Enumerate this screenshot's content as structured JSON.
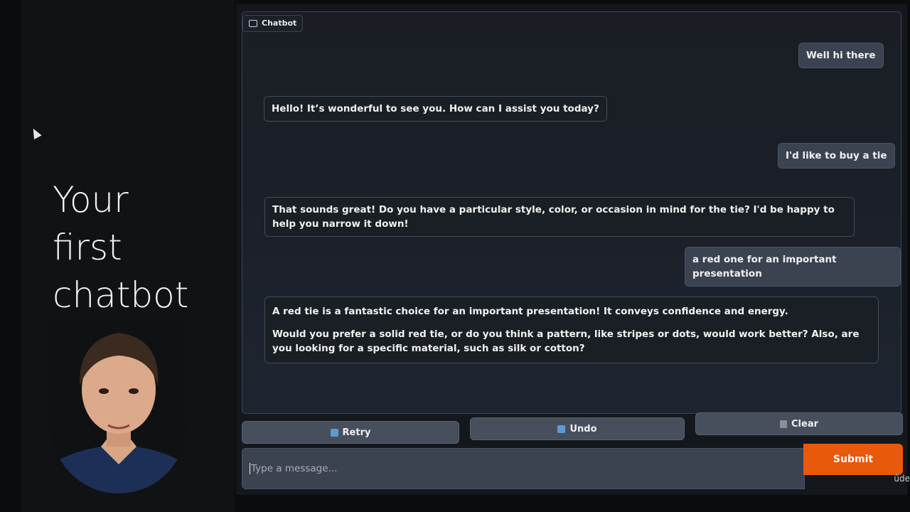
{
  "overlay": {
    "headline_lines": [
      "Your",
      "first",
      "chatbot"
    ],
    "watermark": "ûde"
  },
  "chatbot": {
    "label": "Chatbot",
    "messages": [
      {
        "role": "user",
        "text": "Well hi there"
      },
      {
        "role": "bot",
        "text": "Hello! It’s wonderful to see you. How can I assist you today?"
      },
      {
        "role": "user",
        "text": "I'd like to buy a tie"
      },
      {
        "role": "bot",
        "text": "That sounds great! Do you have a particular style, color, or occasion in mind for the tie? I'd be happy to help you narrow it down!"
      },
      {
        "role": "user",
        "text": "a red one for an important presentation"
      },
      {
        "role": "bot",
        "paragraphs": [
          "A red tie is a fantastic choice for an important presentation! It conveys confidence and energy.",
          "Would you prefer a solid red tie, or do you think a pattern, like stripes or dots, would work better? Also, are you looking for a specific material, such as silk or cotton?"
        ]
      }
    ]
  },
  "controls": {
    "retry_label": "Retry",
    "undo_label": "Undo",
    "clear_label": "Clear"
  },
  "composer": {
    "placeholder": "Type a message...",
    "submit_label": "Submit"
  },
  "colors": {
    "submit": "#e8590c",
    "user_bubble": "#3b4250",
    "bot_bubble": "#1a1e25"
  }
}
